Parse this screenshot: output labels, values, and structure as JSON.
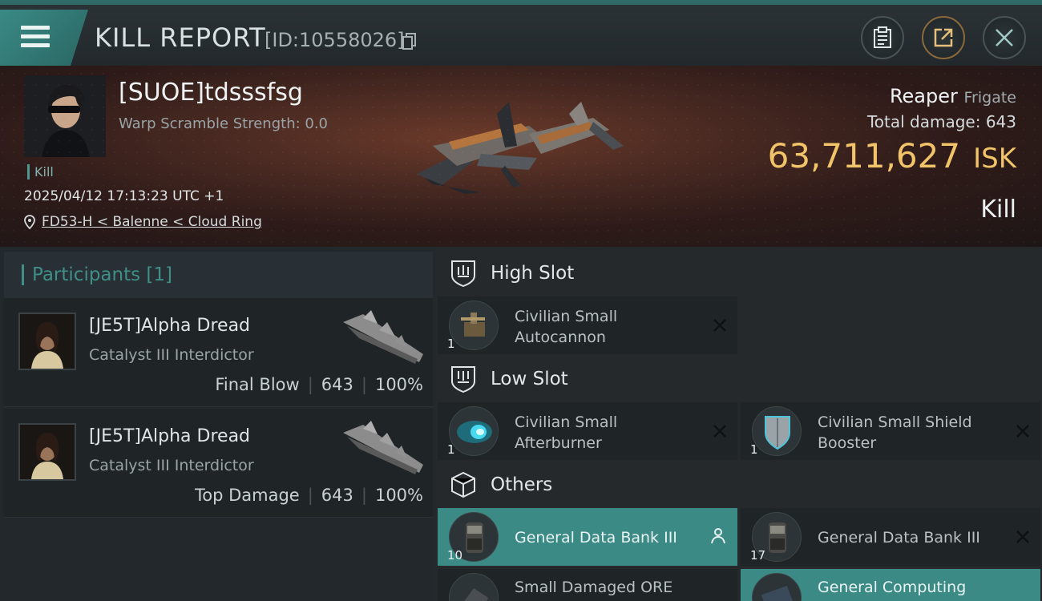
{
  "header": {
    "title": "KILL REPORT",
    "report_id": "[ID:10558026]"
  },
  "victim": {
    "name": "[SUOE]tdsssfsg",
    "warp_scramble": "Warp Scramble Strength: 0.0",
    "tag": "Kill",
    "datetime": "2025/04/12 17:13:23 UTC +1",
    "location": "FD53-H < Balenne < Cloud Ring",
    "ship_name": "Reaper",
    "ship_class": "Frigate",
    "total_damage_label": "Total damage:",
    "total_damage": "643",
    "isk_value": "63,711,627",
    "isk_unit": "ISK",
    "result": "Kill"
  },
  "participants": {
    "label": "Participants [1]",
    "rows": [
      {
        "name": "[JE5T]Alpha Dread",
        "ship": "Catalyst III Interdictor",
        "role": "Final Blow",
        "damage": "643",
        "percent": "100%"
      },
      {
        "name": "[JE5T]Alpha Dread",
        "ship": "Catalyst III Interdictor",
        "role": "Top Damage",
        "damage": "643",
        "percent": "100%"
      }
    ]
  },
  "slots": {
    "high": {
      "title": "High Slot",
      "items": [
        {
          "line1": "Civilian Small",
          "line2": "Autocannon",
          "qty": "1"
        }
      ]
    },
    "low": {
      "title": "Low Slot",
      "items": [
        {
          "line1": "Civilian Small",
          "line2": "Afterburner",
          "qty": "1"
        },
        {
          "line1": "Civilian Small Shield",
          "line2": "Booster",
          "qty": "1"
        }
      ]
    },
    "others": {
      "title": "Others",
      "items": [
        {
          "line1": "General Data Bank III",
          "qty": "10"
        },
        {
          "line1": "General Data Bank III",
          "qty": "17"
        },
        {
          "line1": "Small Damaged ORE"
        },
        {
          "line1": "General Computing"
        }
      ]
    }
  },
  "colors": {
    "accent": "#3b8a85",
    "isk": "#f2c46a"
  }
}
